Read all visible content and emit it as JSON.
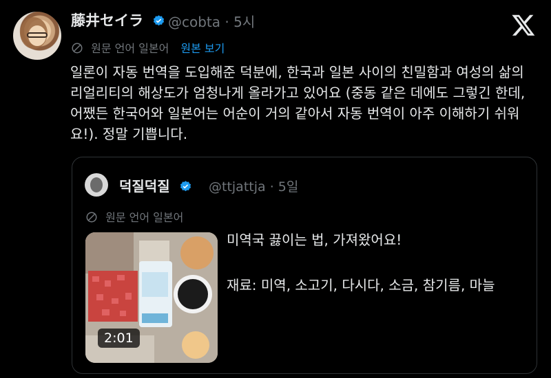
{
  "tweet": {
    "author_name": "藤井セイラ",
    "handle": "@cobta",
    "time": "· 5시",
    "source_language": "원문 언어 일본어",
    "show_original": "원본 보기",
    "text": "일론이 자동 번역을 도입해준 덕분에, 한국과 일본 사이의 친밀함과 여성의 삶의 리얼리티의 해상도가 엄청나게 올라가고 있어요 (중동 같은 데에도 그렇긴 한데, 어쨌든 한국어와 일본어는 어순이 거의 같아서 자동 번역이 아주 이해하기 쉬워요!). 정말 기쁩니다."
  },
  "quoted": {
    "author_name": "덕질덕질",
    "handle": "@ttjattja",
    "time": "· 5일",
    "source_language": "원문 언어 일본어",
    "video_duration": "2:01",
    "text_line1": "미역국 끓이는 법, 가져왔어요!",
    "text_line2": "재료: 미역, 소고기, 다시다, 소금, 참기름, 마늘"
  },
  "icons": {
    "verified": "verified-badge-icon",
    "x_logo": "x-logo-icon",
    "translate": "globe-translate-icon"
  },
  "colors": {
    "background": "#000000",
    "text": "#e7e9ea",
    "muted": "#71767b",
    "link": "#1d9bf0",
    "verified": "#1d9bf0",
    "border": "#2f3336"
  }
}
